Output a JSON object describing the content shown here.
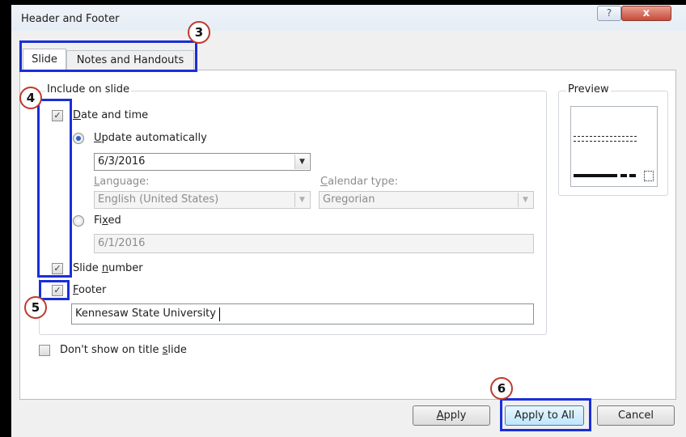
{
  "dialog": {
    "title": "Header and Footer",
    "help_label": "?",
    "close_label": "x"
  },
  "tabs": [
    {
      "label": "Slide",
      "selected": true
    },
    {
      "label": "Notes and Handouts",
      "selected": false
    }
  ],
  "include": {
    "legend": "Include on slide",
    "date_time": {
      "label": "Date and time",
      "checked": true
    },
    "update_auto": {
      "label": "Update automatically",
      "selected": true,
      "value": "6/3/2016"
    },
    "language": {
      "label": "Language:",
      "value": "English (United States)"
    },
    "calendar": {
      "label": "Calendar type:",
      "value": "Gregorian"
    },
    "fixed": {
      "label": "Fixed",
      "selected": false,
      "value": "6/1/2016"
    },
    "slide_number": {
      "label": "Slide number",
      "checked": true
    },
    "footer": {
      "label": "Footer",
      "checked": true,
      "value": "Kennesaw State University"
    }
  },
  "dont_show": {
    "label": "Don't show on title slide",
    "checked": false
  },
  "preview": {
    "label": "Preview"
  },
  "buttons": {
    "apply": "Apply",
    "apply_all": "Apply to All",
    "cancel": "Cancel"
  },
  "callouts": [
    "3",
    "4",
    "5",
    "6"
  ],
  "colors": {
    "highlight": "#1b2ed8",
    "callout_ring": "#c0392b"
  }
}
